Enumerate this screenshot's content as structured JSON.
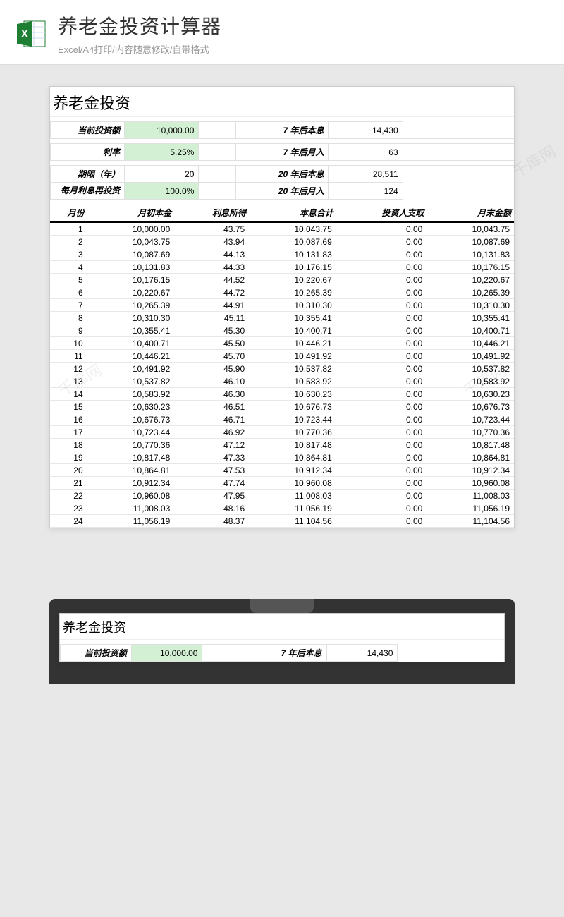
{
  "header": {
    "title": "养老金投资计算器",
    "subtitle": "Excel/A4打印/内容随意修改/自带格式"
  },
  "sheet": {
    "title": "养老金投资",
    "params": {
      "invest_label": "当前投资额",
      "invest_value": "10,000.00",
      "rate_label": "利率",
      "rate_value": "5.25%",
      "term_label": "期限（年）",
      "term_value": "20",
      "reinvest_label": "每月利息再投资",
      "reinvest_value": "100.0%",
      "y7_principal_label": "7 年后本息",
      "y7_principal_value": "14,430",
      "y7_monthly_label": "7 年后月入",
      "y7_monthly_value": "63",
      "y20_principal_label": "20 年后本息",
      "y20_principal_value": "28,511",
      "y20_monthly_label": "20 年后月入",
      "y20_monthly_value": "124"
    },
    "columns": [
      "月份",
      "月初本金",
      "利息所得",
      "本息合计",
      "投资人支取",
      "月末金额"
    ],
    "rows": [
      [
        "1",
        "10,000.00",
        "43.75",
        "10,043.75",
        "0.00",
        "10,043.75"
      ],
      [
        "2",
        "10,043.75",
        "43.94",
        "10,087.69",
        "0.00",
        "10,087.69"
      ],
      [
        "3",
        "10,087.69",
        "44.13",
        "10,131.83",
        "0.00",
        "10,131.83"
      ],
      [
        "4",
        "10,131.83",
        "44.33",
        "10,176.15",
        "0.00",
        "10,176.15"
      ],
      [
        "5",
        "10,176.15",
        "44.52",
        "10,220.67",
        "0.00",
        "10,220.67"
      ],
      [
        "6",
        "10,220.67",
        "44.72",
        "10,265.39",
        "0.00",
        "10,265.39"
      ],
      [
        "7",
        "10,265.39",
        "44.91",
        "10,310.30",
        "0.00",
        "10,310.30"
      ],
      [
        "8",
        "10,310.30",
        "45.11",
        "10,355.41",
        "0.00",
        "10,355.41"
      ],
      [
        "9",
        "10,355.41",
        "45.30",
        "10,400.71",
        "0.00",
        "10,400.71"
      ],
      [
        "10",
        "10,400.71",
        "45.50",
        "10,446.21",
        "0.00",
        "10,446.21"
      ],
      [
        "11",
        "10,446.21",
        "45.70",
        "10,491.92",
        "0.00",
        "10,491.92"
      ],
      [
        "12",
        "10,491.92",
        "45.90",
        "10,537.82",
        "0.00",
        "10,537.82"
      ],
      [
        "13",
        "10,537.82",
        "46.10",
        "10,583.92",
        "0.00",
        "10,583.92"
      ],
      [
        "14",
        "10,583.92",
        "46.30",
        "10,630.23",
        "0.00",
        "10,630.23"
      ],
      [
        "15",
        "10,630.23",
        "46.51",
        "10,676.73",
        "0.00",
        "10,676.73"
      ],
      [
        "16",
        "10,676.73",
        "46.71",
        "10,723.44",
        "0.00",
        "10,723.44"
      ],
      [
        "17",
        "10,723.44",
        "46.92",
        "10,770.36",
        "0.00",
        "10,770.36"
      ],
      [
        "18",
        "10,770.36",
        "47.12",
        "10,817.48",
        "0.00",
        "10,817.48"
      ],
      [
        "19",
        "10,817.48",
        "47.33",
        "10,864.81",
        "0.00",
        "10,864.81"
      ],
      [
        "20",
        "10,864.81",
        "47.53",
        "10,912.34",
        "0.00",
        "10,912.34"
      ],
      [
        "21",
        "10,912.34",
        "47.74",
        "10,960.08",
        "0.00",
        "10,960.08"
      ],
      [
        "22",
        "10,960.08",
        "47.95",
        "11,008.03",
        "0.00",
        "11,008.03"
      ],
      [
        "23",
        "11,008.03",
        "48.16",
        "11,056.19",
        "0.00",
        "11,056.19"
      ],
      [
        "24",
        "11,056.19",
        "48.37",
        "11,104.56",
        "0.00",
        "11,104.56"
      ]
    ]
  },
  "watermark": "千库网"
}
